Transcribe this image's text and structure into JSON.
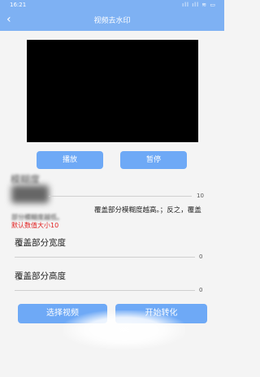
{
  "status_bar": {
    "time": "16:21",
    "icons_text": "ıll ıll ≋ ▭"
  },
  "header": {
    "back_icon": "chevron-left-icon",
    "title": "视频去水印"
  },
  "player": {
    "play_label": "播放",
    "pause_label": "暂停"
  },
  "blur_section": {
    "title_blurred": "模糊度",
    "value_max": "10",
    "description": "覆盖部分模糊度越高。；反之，覆盖",
    "description_left_blurred": "部分模糊度越低。",
    "default_hint": "默认数值大小10"
  },
  "width_section": {
    "label": "覆盖部分宽度",
    "value": "0"
  },
  "height_section": {
    "label": "覆盖部分高度",
    "value": "0"
  },
  "actions": {
    "select_video_label": "选择视频",
    "start_convert_label": "开始转化"
  },
  "colors": {
    "accent": "#7eb1f3",
    "button": "#6ea9f6",
    "hint_red": "#e02020"
  }
}
